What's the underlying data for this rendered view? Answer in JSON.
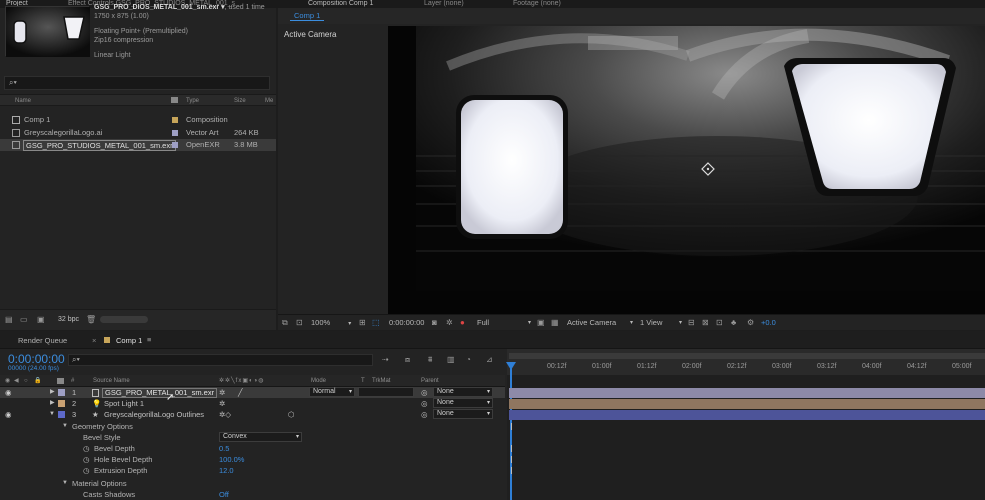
{
  "top_tabs": {
    "project": "Project",
    "effect_controls": "Effect Controls GSG_PRO_STUDIOS_METAL_001_s",
    "composition": "Composition Comp 1",
    "layer": "Layer (none)",
    "footage": "Footage (none)"
  },
  "project_panel": {
    "file_name": "GSG_PRO_DIOS_METAL_001_sm.exr ▾",
    "used_count": ", used 1 time",
    "dimensions": "1750 x 875 (1.00)",
    "color_depth": "Floating Point+ (Premultiplied)",
    "compression": "Zip16 compression",
    "color_space": "Linear Light",
    "search_glyph": "⌕▾",
    "columns": {
      "name": "Name",
      "type": "Type",
      "size": "Size",
      "extra": "Me"
    },
    "items": [
      {
        "name": "Comp 1",
        "type": "Composition",
        "size": "",
        "color": "#c7a55a"
      },
      {
        "name": "GreyscalegorillaLogo.ai",
        "type": "Vector Art",
        "size": "264 KB",
        "color": "#9e9fc4"
      },
      {
        "name": "GSG_PRO_STUDIOS_METAL_001_sm.exr",
        "type": "OpenEXR",
        "size": "3.8 MB",
        "color": "#9e9fc4"
      }
    ],
    "bpc": "32 bpc"
  },
  "viewer": {
    "comp_tab": "Comp 1",
    "camera_label": "Active Camera",
    "zoom": "100%",
    "timecode": "0:00:00:00",
    "resolution": "Full",
    "camera_select": "Active Camera",
    "view_select": "1 View",
    "exposure": "+0.0"
  },
  "timeline": {
    "render_queue_tab": "Render Queue",
    "comp_tab": "Comp 1",
    "current_time": "0:00:00:00",
    "frame_info": "00000 (24.00 fps)",
    "search_glyph": "⌕▾",
    "ruler_labels": [
      "00:12f",
      "01:00f",
      "01:12f",
      "02:00f",
      "02:12f",
      "03:00f",
      "03:12f",
      "04:00f",
      "04:12f",
      "05:00f"
    ],
    "column_headers": {
      "hash": "#",
      "source_name": "Source Name",
      "mode": "Mode",
      "t": "T",
      "trkmat": "TrkMat",
      "parent": "Parent"
    },
    "layers": [
      {
        "num": "1",
        "name": "GSG_PRO_METAL_001_sm.exr",
        "mode": "Normal",
        "parent": "None",
        "label_color": "#9e9fc4",
        "bar_color": "#8d8aa8"
      },
      {
        "num": "2",
        "name": "Spot Light 1",
        "mode": "",
        "parent": "None",
        "label_color": "#c9a173",
        "bar_color": "#8f7660"
      },
      {
        "num": "3",
        "name": "GreyscalegorillaLogo Outlines",
        "mode": "",
        "parent": "None",
        "label_color": "#5d69c9",
        "bar_color": "#4d5499"
      }
    ],
    "properties": [
      {
        "label": "Geometry Options",
        "value": "",
        "kind": "group"
      },
      {
        "label": "Bevel Style",
        "value": "Convex",
        "kind": "dropdown"
      },
      {
        "label": "Bevel Depth",
        "value": "0.5",
        "kind": "value"
      },
      {
        "label": "Hole Bevel Depth",
        "value": "100.0%",
        "kind": "value"
      },
      {
        "label": "Extrusion Depth",
        "value": "12.0",
        "kind": "value"
      },
      {
        "label": "Material Options",
        "value": "",
        "kind": "group"
      },
      {
        "label": "Casts Shadows",
        "value": "Off",
        "kind": "value"
      }
    ]
  },
  "colors": {
    "accent_blue": "#3b8dde",
    "panel_bg": "#232323",
    "playhead": "#2f7fd6"
  }
}
